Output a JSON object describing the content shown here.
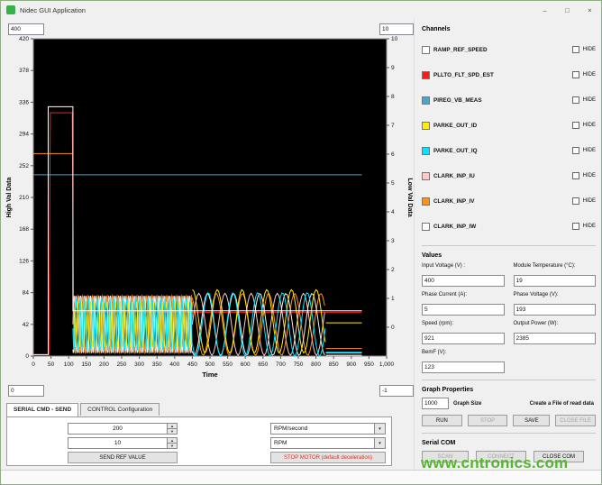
{
  "window": {
    "title": "Nidec GUI Application"
  },
  "icons": {
    "minimize": "–",
    "maximize": "□",
    "close": "×",
    "spinner_up": "▲",
    "spinner_down": "▼",
    "dropdown_arrow": "▼"
  },
  "chart": {
    "axis_inputs": {
      "y_left_max": "400",
      "y_right_max": "10",
      "y_left_min": "0",
      "y_right_min": "-1"
    }
  },
  "chart_data": {
    "type": "line",
    "xlabel": "Time",
    "ylabel_left": "High Val Data",
    "ylabel_right": "Low Val Data",
    "xlim": [
      0,
      1000
    ],
    "ylim_left": [
      0,
      420
    ],
    "ylim_right": [
      -1,
      10
    ],
    "background": "#000000",
    "grid": false,
    "y_left_ticks": [
      420,
      378,
      336,
      294,
      252,
      210,
      168,
      126,
      84,
      42,
      0
    ],
    "y_right_ticks": [
      10,
      9,
      8,
      7,
      6,
      5,
      4,
      3,
      2,
      1,
      0
    ],
    "x_tick_values": [
      0,
      50,
      100,
      150,
      200,
      250,
      300,
      350,
      400,
      450,
      500,
      550,
      600,
      650,
      700,
      750,
      800,
      850,
      900,
      950,
      1000
    ],
    "x_tick_labels": [
      "0",
      "50",
      "100",
      "150",
      "200",
      "250",
      "300",
      "350",
      "400",
      "450",
      "500",
      "550",
      "600",
      "650",
      "700",
      "750",
      "800",
      "850",
      "900",
      "950",
      "1,000"
    ],
    "series": [
      {
        "name": "PLLTO_FLT_SPD_EST",
        "color": "#ff1a1a",
        "segments": [
          {
            "points": [
              [
                0,
                2
              ],
              [
                44,
                2
              ],
              [
                48,
                322
              ],
              [
                110,
                322
              ],
              [
                114,
                58
              ],
              [
                930,
                58
              ]
            ]
          }
        ]
      },
      {
        "name": "PIREG_VB_MEAS",
        "color": "#45a8cc",
        "segments": [
          {
            "points": [
              [
                0,
                240
              ],
              [
                930,
                240
              ]
            ]
          }
        ]
      },
      {
        "name": "CLARK_INP_IU",
        "color": "#ffc9c9",
        "segments": [
          {
            "sine": {
              "x0": 112,
              "x1": 450,
              "center": 42,
              "amp": 38,
              "period": 14,
              "phase": 0
            }
          },
          {
            "sine": {
              "x0": 450,
              "x1": 828,
              "center": 42,
              "amp": 41,
              "period": 74,
              "phase": 0
            }
          },
          {
            "points": [
              [
                828,
                4
              ],
              [
                930,
                4
              ]
            ]
          }
        ]
      },
      {
        "name": "CLARK_INP_IV",
        "color": "#ff9019",
        "segments": [
          {
            "points": [
              [
                0,
                268
              ],
              [
                112,
                268
              ]
            ]
          },
          {
            "sine": {
              "x0": 112,
              "x1": 450,
              "center": 42,
              "amp": 38,
              "period": 14,
              "phase": 2.1
            }
          },
          {
            "sine": {
              "x0": 450,
              "x1": 828,
              "center": 42,
              "amp": 41,
              "period": 74,
              "phase": 2.1
            }
          },
          {
            "points": [
              [
                828,
                10
              ],
              [
                930,
                10
              ]
            ]
          }
        ]
      },
      {
        "name": "CLARK_INP_IW",
        "color": "#f2f2f2",
        "segments": [
          {
            "sine": {
              "x0": 112,
              "x1": 450,
              "center": 42,
              "amp": 38,
              "period": 14,
              "phase": 4.2
            }
          },
          {
            "sine": {
              "x0": 450,
              "x1": 828,
              "center": 42,
              "amp": 41,
              "period": 74,
              "phase": 4.2
            }
          },
          {
            "points": [
              [
                828,
                1
              ],
              [
                930,
                1
              ]
            ]
          }
        ]
      },
      {
        "name": "PARKE_OUT_ID",
        "color": "#ffee00",
        "segments": [
          {
            "sine": {
              "x0": 112,
              "x1": 450,
              "center": 42,
              "amp": 30,
              "period": 12,
              "phase": 1.2
            }
          },
          {
            "sine": {
              "x0": 450,
              "x1": 828,
              "center": 46,
              "amp": 42,
              "period": 70,
              "phase": 1.5
            }
          },
          {
            "points": [
              [
                828,
                44
              ],
              [
                930,
                44
              ]
            ]
          }
        ]
      },
      {
        "name": "PARKE_OUT_IQ",
        "color": "#00e5ff",
        "segments": [
          {
            "sine": {
              "x0": 112,
              "x1": 450,
              "center": 42,
              "amp": 34,
              "period": 12,
              "phase": 3.3
            }
          },
          {
            "sine": {
              "x0": 450,
              "x1": 828,
              "center": 42,
              "amp": 42,
              "period": 70,
              "phase": 3.8
            }
          },
          {
            "points": [
              [
                828,
                5
              ],
              [
                930,
                5
              ]
            ]
          }
        ]
      },
      {
        "name": "RAMP_REF_SPEED",
        "color": "#ffffff",
        "segments": [
          {
            "points": [
              [
                0,
                2
              ],
              [
                42,
                2
              ],
              [
                42,
                330
              ],
              [
                112,
                330
              ],
              [
                112,
                60
              ],
              [
                930,
                60
              ]
            ]
          }
        ]
      }
    ]
  },
  "channels": {
    "header": "Channels",
    "hide_label": "HIDE",
    "items": [
      {
        "label": "RAMP_REF_SPEED",
        "color": "#ffffff"
      },
      {
        "label": "PLLTO_FLT_SPD_EST",
        "color": "#ff1a1a"
      },
      {
        "label": "PIREG_VB_MEAS",
        "color": "#45a8cc"
      },
      {
        "label": "PARKE_OUT_ID",
        "color": "#ffee00"
      },
      {
        "label": "PARKE_OUT_IQ",
        "color": "#00e5ff"
      },
      {
        "label": "CLARK_INP_IU",
        "color": "#ffc9c9"
      },
      {
        "label": "CLARK_INP_IV",
        "color": "#ff9019"
      },
      {
        "label": "CLARK_INP_IW",
        "color": "#ffffff"
      }
    ]
  },
  "values": {
    "header": "Values",
    "fields": [
      {
        "label": "Input Voltage (V) :",
        "value": "400"
      },
      {
        "label": "Module Temperature (°C):",
        "value": "19"
      },
      {
        "label": "Phase Current (A):",
        "value": "5"
      },
      {
        "label": "Phase Voltage (V):",
        "value": "193"
      },
      {
        "label": "Speed (rpm):",
        "value": "921"
      },
      {
        "label": "Output Power (W):",
        "value": "2385"
      },
      {
        "label": "BemF (V):",
        "value": "123"
      }
    ]
  },
  "graph_properties": {
    "header": "Graph Properties",
    "graph_size_value": "1000",
    "graph_size_label": "Graph Size",
    "file_text": "Create a File of read data",
    "run": "RUN",
    "stop": "STOP",
    "save": "SAVE",
    "close_file": "CLOSE FILE"
  },
  "serial_com": {
    "header": "Serial COM",
    "scan": "SCAN",
    "connect": "CONNECT",
    "close_com": "CLOSE COM"
  },
  "tabs": [
    {
      "label": "SERIAL CMD - SEND",
      "active": true
    },
    {
      "label": "CONTROL Configuration",
      "active": false
    }
  ],
  "control_panel": {
    "ref_value": "200",
    "ref_step": "10",
    "send_button": "SEND REF VALUE",
    "dropdown1": "RPM/second",
    "dropdown2": "RPM",
    "stop_button": "STOP MOTOR (default deceleration)"
  },
  "watermark": {
    "text": "www.cntronics.com",
    "color": "#58b531"
  }
}
